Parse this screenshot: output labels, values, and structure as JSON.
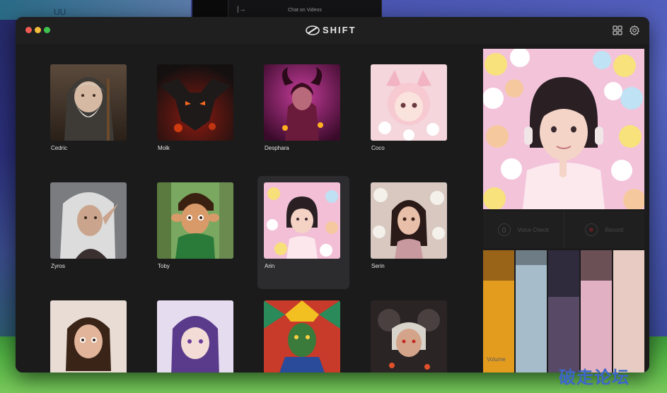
{
  "desktop": {
    "topbar_title": "Chat on Videos",
    "topbar_glyph": "|→",
    "corner_glyph": "UU"
  },
  "app": {
    "brand": "SHIFT",
    "icons": [
      "grid-icon",
      "gear-icon"
    ]
  },
  "characters": [
    {
      "name": "Cedric",
      "selected": false
    },
    {
      "name": "Molk",
      "selected": false
    },
    {
      "name": "Desphara",
      "selected": false
    },
    {
      "name": "Coco",
      "selected": false
    },
    {
      "name": "Zyros",
      "selected": false
    },
    {
      "name": "Toby",
      "selected": false
    },
    {
      "name": "Arin",
      "selected": true
    },
    {
      "name": "Serin",
      "selected": false
    },
    {
      "name": "",
      "selected": false
    },
    {
      "name": "",
      "selected": false
    },
    {
      "name": "",
      "selected": false
    },
    {
      "name": "",
      "selected": false
    }
  ],
  "panel": {
    "voice_check_label": "Voice Check",
    "record_label": "Record",
    "volume_label": "Volume"
  },
  "palette": [
    {
      "top": "#9a6418",
      "bottom": "#e49c1f",
      "split": 0.25
    },
    {
      "top": "#6e7c86",
      "bottom": "#a6bccb",
      "split": 0.12
    },
    {
      "top": "#2f2a3c",
      "bottom": "#584a66",
      "split": 0.38
    },
    {
      "top": "#6b5056",
      "bottom": "#e2b0c3",
      "split": 0.25
    },
    {
      "top": "#e8cbc3",
      "bottom": "#e8cbc3",
      "split": 0.0
    }
  ],
  "watermark": "破走论坛"
}
